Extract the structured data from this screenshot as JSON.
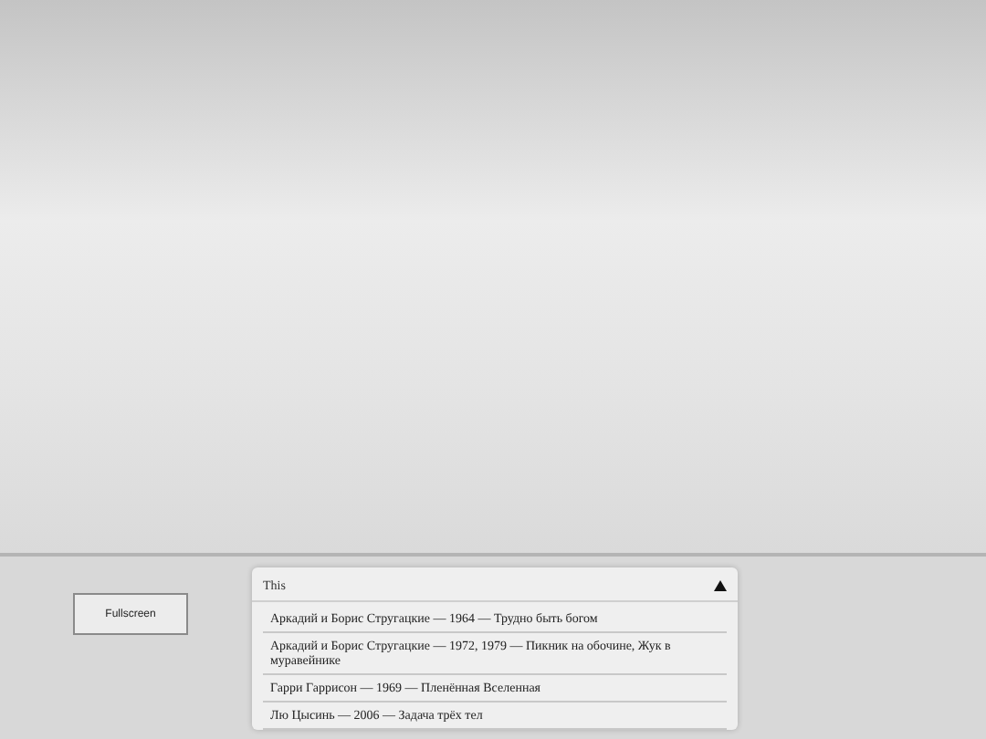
{
  "fullscreen_button": {
    "label": "Fullscreen"
  },
  "dropdown": {
    "title": "This",
    "expanded": true,
    "items": [
      {
        "text": "Аркадий и Борис Стругацкие — 1964 — Трудно быть богом"
      },
      {
        "text": "Аркадий и Борис Стругацкие — 1972, 1979 — Пикник на обочине, Жук в муравейнике"
      },
      {
        "text": "Гарри Гаррисон — 1969 — Пленённая Вселенная"
      },
      {
        "text": "Лю Цысинь — 2006 — Задача трёх тел"
      }
    ]
  }
}
